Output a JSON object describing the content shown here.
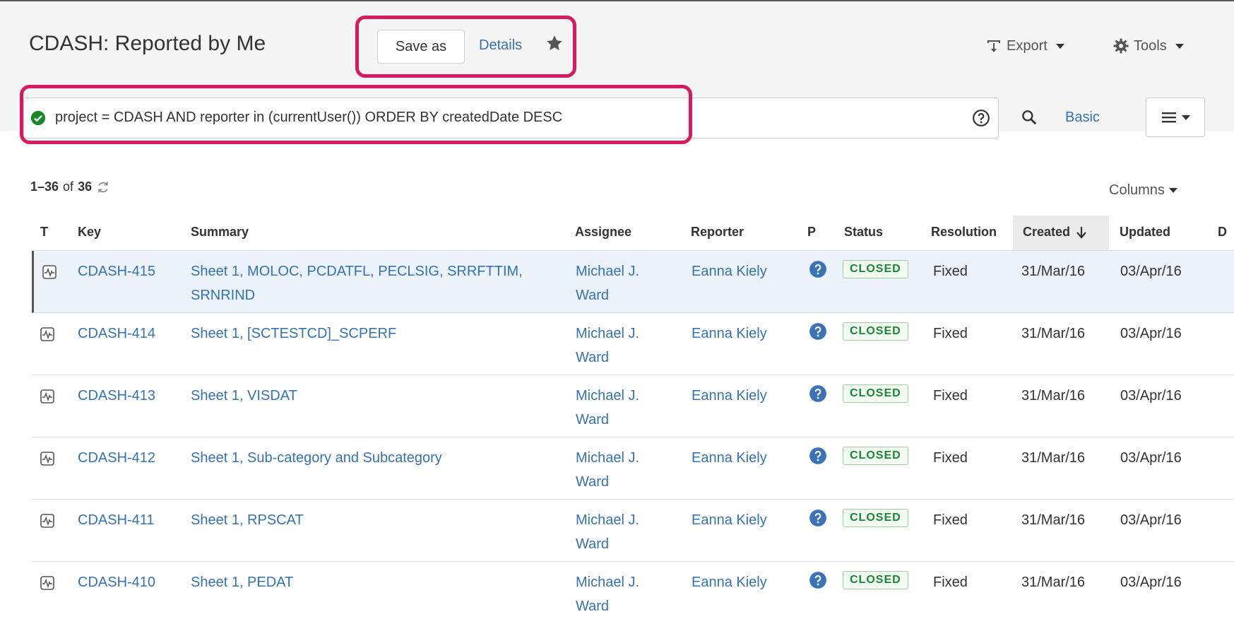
{
  "header": {
    "title": "CDASH: Reported by Me",
    "save_as_label": "Save as",
    "details_label": "Details",
    "export_label": "Export",
    "tools_label": "Tools"
  },
  "search": {
    "jql": "project = CDASH AND reporter in (currentUser()) ORDER BY createdDate DESC",
    "basic_label": "Basic"
  },
  "results": {
    "range": "1–36",
    "of_label": "of",
    "total": "36",
    "columns_label": "Columns"
  },
  "table": {
    "headers": {
      "type": "T",
      "key": "Key",
      "summary": "Summary",
      "assignee": "Assignee",
      "reporter": "Reporter",
      "priority": "P",
      "status": "Status",
      "resolution": "Resolution",
      "created": "Created",
      "updated": "Updated",
      "due": "D"
    },
    "rows": [
      {
        "key": "CDASH-415",
        "summary": "Sheet 1, MOLOC, PCDATFL, PECLSIG, SRRFTTIM, SRNRIND",
        "assignee": "Michael J. Ward",
        "reporter": "Eanna Kiely",
        "status": "CLOSED",
        "resolution": "Fixed",
        "created": "31/Mar/16",
        "updated": "03/Apr/16"
      },
      {
        "key": "CDASH-414",
        "summary": "Sheet 1, [SCTESTCD]_SCPERF",
        "assignee": "Michael J. Ward",
        "reporter": "Eanna Kiely",
        "status": "CLOSED",
        "resolution": "Fixed",
        "created": "31/Mar/16",
        "updated": "03/Apr/16"
      },
      {
        "key": "CDASH-413",
        "summary": "Sheet 1, VISDAT",
        "assignee": "Michael J. Ward",
        "reporter": "Eanna Kiely",
        "status": "CLOSED",
        "resolution": "Fixed",
        "created": "31/Mar/16",
        "updated": "03/Apr/16"
      },
      {
        "key": "CDASH-412",
        "summary": "Sheet 1, Sub-category and Subcategory",
        "assignee": "Michael J. Ward",
        "reporter": "Eanna Kiely",
        "status": "CLOSED",
        "resolution": "Fixed",
        "created": "31/Mar/16",
        "updated": "03/Apr/16"
      },
      {
        "key": "CDASH-411",
        "summary": "Sheet 1, RPSCAT",
        "assignee": "Michael J. Ward",
        "reporter": "Eanna Kiely",
        "status": "CLOSED",
        "resolution": "Fixed",
        "created": "31/Mar/16",
        "updated": "03/Apr/16"
      },
      {
        "key": "CDASH-410",
        "summary": "Sheet 1, PEDAT",
        "assignee": "Michael J. Ward",
        "reporter": "Eanna Kiely",
        "status": "CLOSED",
        "resolution": "Fixed",
        "created": "31/Mar/16",
        "updated": "03/Apr/16"
      }
    ]
  },
  "icons": {
    "star": "star-icon",
    "export": "export-icon",
    "tools": "gear-icon",
    "valid_query": "check-circle-icon",
    "help": "help-icon",
    "search": "search-icon",
    "menu": "menu-icon",
    "refresh": "refresh-icon",
    "sort": "sort-desc-icon",
    "issue_type": "issue-type-icon",
    "priority": "priority-icon"
  },
  "colors": {
    "accent": "#3572b0",
    "status_closed": "#14892c",
    "annotation": "#d81b60"
  }
}
